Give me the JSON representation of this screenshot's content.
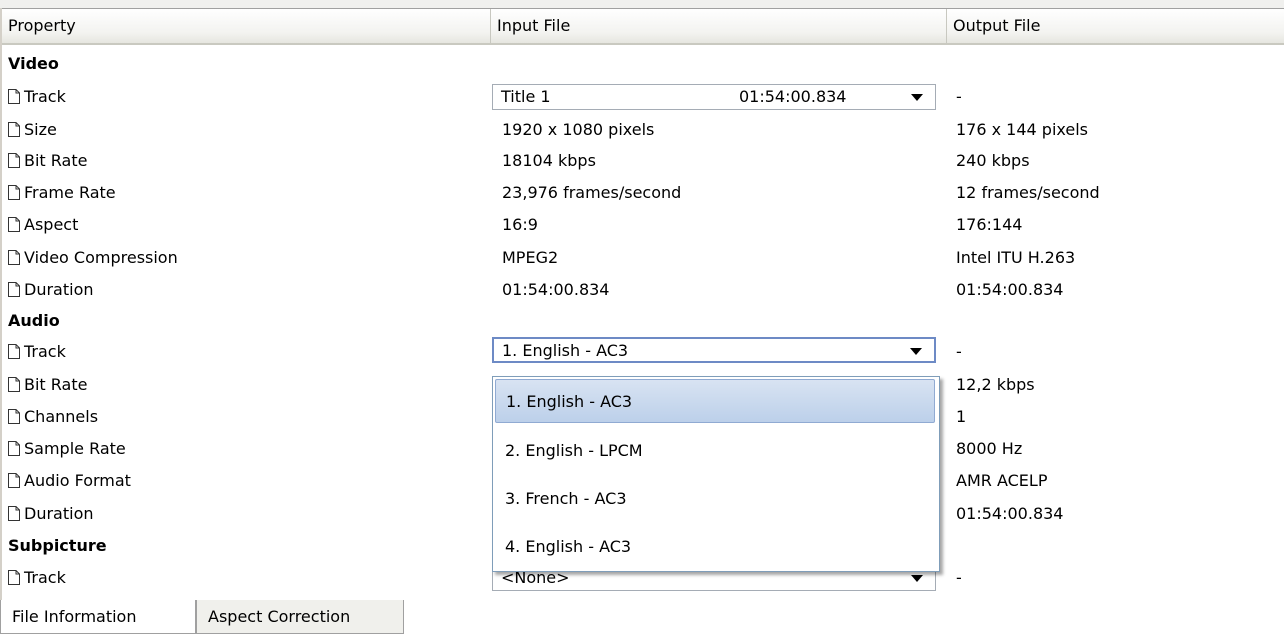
{
  "columns": [
    "Property",
    "Input File",
    "Output File"
  ],
  "sections": {
    "video": "Video",
    "audio": "Audio",
    "subpicture": "Subpicture"
  },
  "video": {
    "track": {
      "label": "Track",
      "input": "Title 1",
      "input_time": "01:54:00.834",
      "output": "-"
    },
    "size": {
      "label": "Size",
      "input": "1920 x 1080 pixels",
      "output": "176 x 144 pixels"
    },
    "bitrate": {
      "label": "Bit Rate",
      "input": "18104 kbps",
      "output": "240 kbps"
    },
    "framerate": {
      "label": "Frame Rate",
      "input": "23,976 frames/second",
      "output": "12 frames/second"
    },
    "aspect": {
      "label": "Aspect",
      "input": "16:9",
      "output": "176:144"
    },
    "compression": {
      "label": "Video Compression",
      "input": "MPEG2",
      "output": "Intel ITU H.263"
    },
    "duration": {
      "label": "Duration",
      "input": "01:54:00.834",
      "output": "01:54:00.834"
    }
  },
  "audio": {
    "track": {
      "label": "Track",
      "input": "1. English - AC3",
      "output": "-"
    },
    "bitrate": {
      "label": "Bit Rate",
      "output": "12,2 kbps"
    },
    "channels": {
      "label": "Channels",
      "output": "1"
    },
    "samplerate": {
      "label": "Sample Rate",
      "output": "8000 Hz"
    },
    "format": {
      "label": "Audio Format",
      "output": "AMR ACELP"
    },
    "duration": {
      "label": "Duration",
      "output": "01:54:00.834"
    },
    "options": [
      "1. English - AC3",
      "2. English - LPCM",
      "3. French - AC3",
      "4. English - AC3"
    ]
  },
  "subpicture": {
    "track": {
      "label": "Track",
      "input": "<None>",
      "output": "-"
    }
  },
  "tabs": [
    "File Information",
    "Aspect Correction"
  ],
  "colors": {
    "selection": "#c6d7ee",
    "focus_border": "#6d8ac5",
    "header_bg": "#f3f3f0"
  },
  "icons": {
    "row": "document-icon",
    "combo": "dropdown-arrow-icon"
  }
}
